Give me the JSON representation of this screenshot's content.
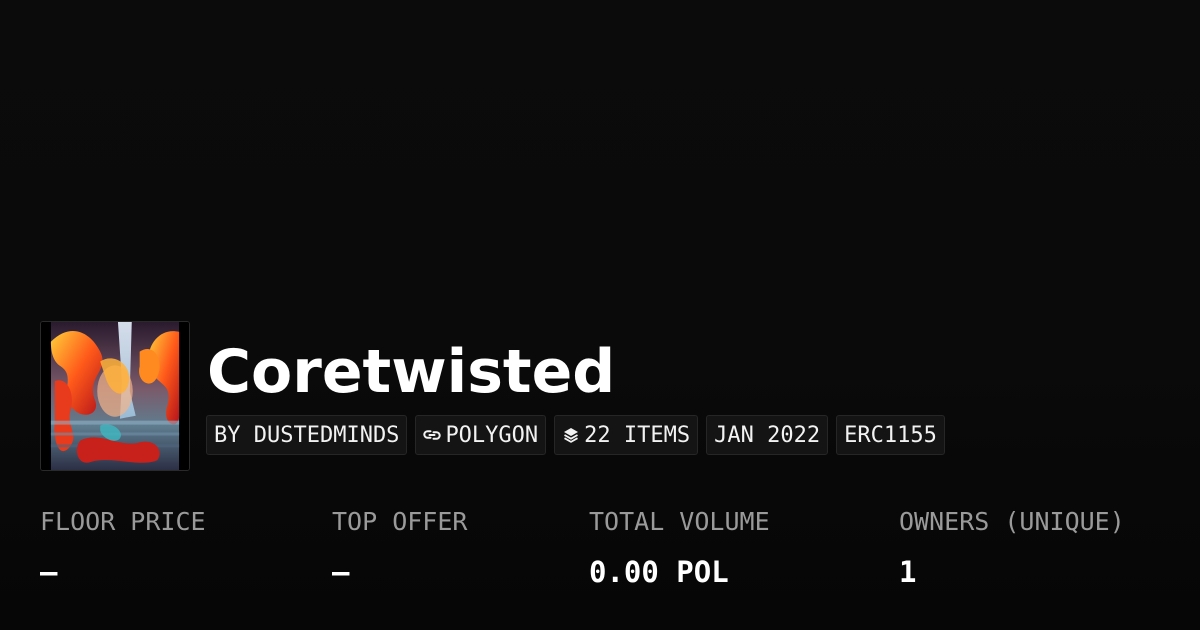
{
  "collection": {
    "name": "Coretwisted",
    "thumbnail_icon": "collection-artwork-image"
  },
  "chips": {
    "creator": "BY DUSTEDMINDS",
    "chain": "POLYGON",
    "chain_icon": "polygon-link-icon",
    "items": "22 ITEMS",
    "items_icon": "layers-icon",
    "date": "JAN 2022",
    "standard": "ERC1155"
  },
  "stats": {
    "floor_price": {
      "label": "FLOOR PRICE",
      "value": "–"
    },
    "top_offer": {
      "label": "TOP OFFER",
      "value": "–"
    },
    "total_volume": {
      "label": "TOTAL VOLUME",
      "value": "0.00 POL"
    },
    "owners": {
      "label": "OWNERS (UNIQUE)",
      "value": "1"
    }
  },
  "colors": {
    "background": "#0a0a0a",
    "chip_background": "#141414",
    "label_gray": "#9a9a9a",
    "text": "#ffffff"
  }
}
